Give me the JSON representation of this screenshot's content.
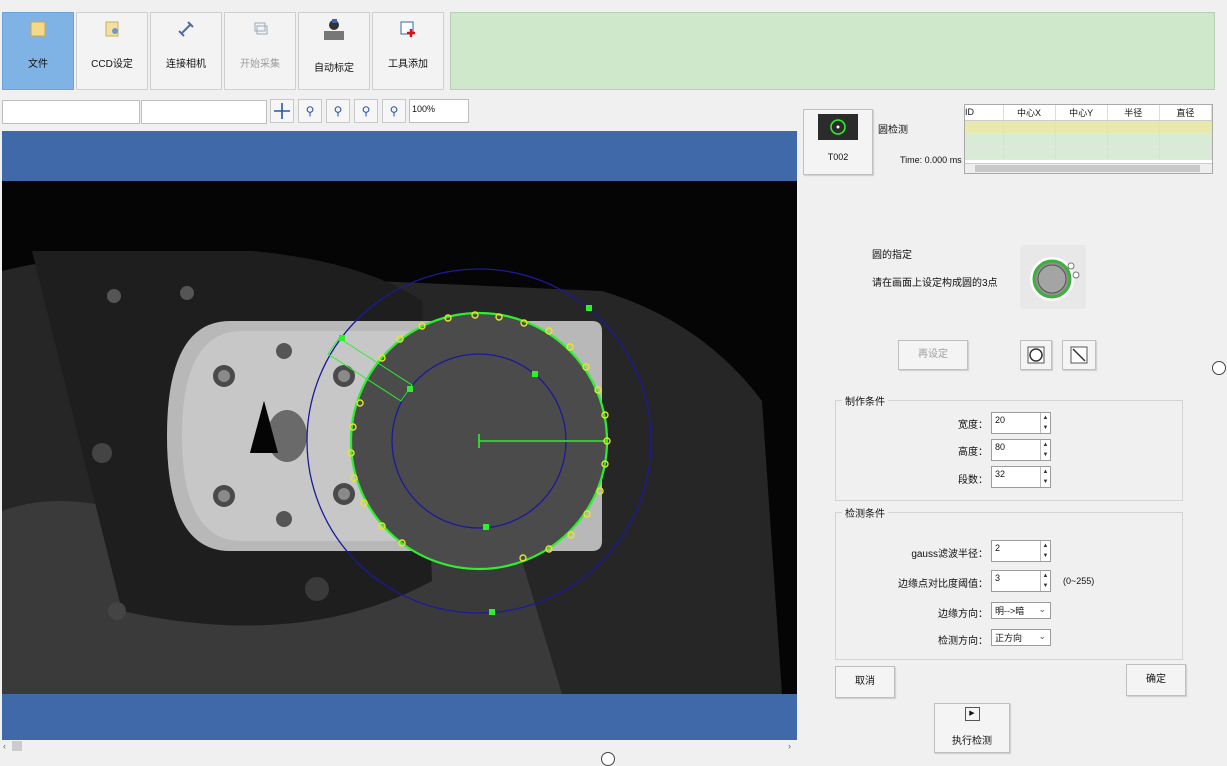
{
  "toolbar": {
    "file": "文件",
    "ccd_settings": "CCD设定",
    "connect_camera": "连接相机",
    "start_capture": "开始采集",
    "auto_calibration": "自动标定",
    "add_tool": "工具添加"
  },
  "view": {
    "zoom_level": "100%"
  },
  "tool": {
    "id": "T002",
    "name": "圆检测",
    "time": "Time: 0.000 ms"
  },
  "results_table": {
    "columns": [
      "ID",
      "中心X",
      "中心Y",
      "半径",
      "直径"
    ]
  },
  "circle_spec": {
    "title": "圆的指定",
    "instruction": "请在画面上设定构成圆的3点",
    "reset_button": "再设定"
  },
  "make_conditions": {
    "title": "制作条件",
    "width_label": "宽度：",
    "width_value": "20",
    "height_label": "高度：",
    "height_value": "80",
    "segments_label": "段数：",
    "segments_value": "32"
  },
  "detect_conditions": {
    "title": "检测条件",
    "gauss_label": "gauss滤波半径：",
    "gauss_value": "2",
    "contrast_label": "边缘点对比度阈值：",
    "contrast_value": "3",
    "contrast_range": "(0~255)",
    "edge_dir_label": "边缘方向：",
    "edge_dir_value": "明-->暗",
    "detect_dir_label": "检测方向：",
    "detect_dir_value": "正方向"
  },
  "buttons": {
    "cancel": "取消",
    "confirm": "确定",
    "execute": "执行检测"
  },
  "colors": {
    "accent_blue": "#3f69a8",
    "status_green": "#cfe8cc",
    "detect_green": "#2cf02c",
    "roi_navy": "#1a1a9c",
    "edge_point_yellow": "#e5e52a"
  }
}
